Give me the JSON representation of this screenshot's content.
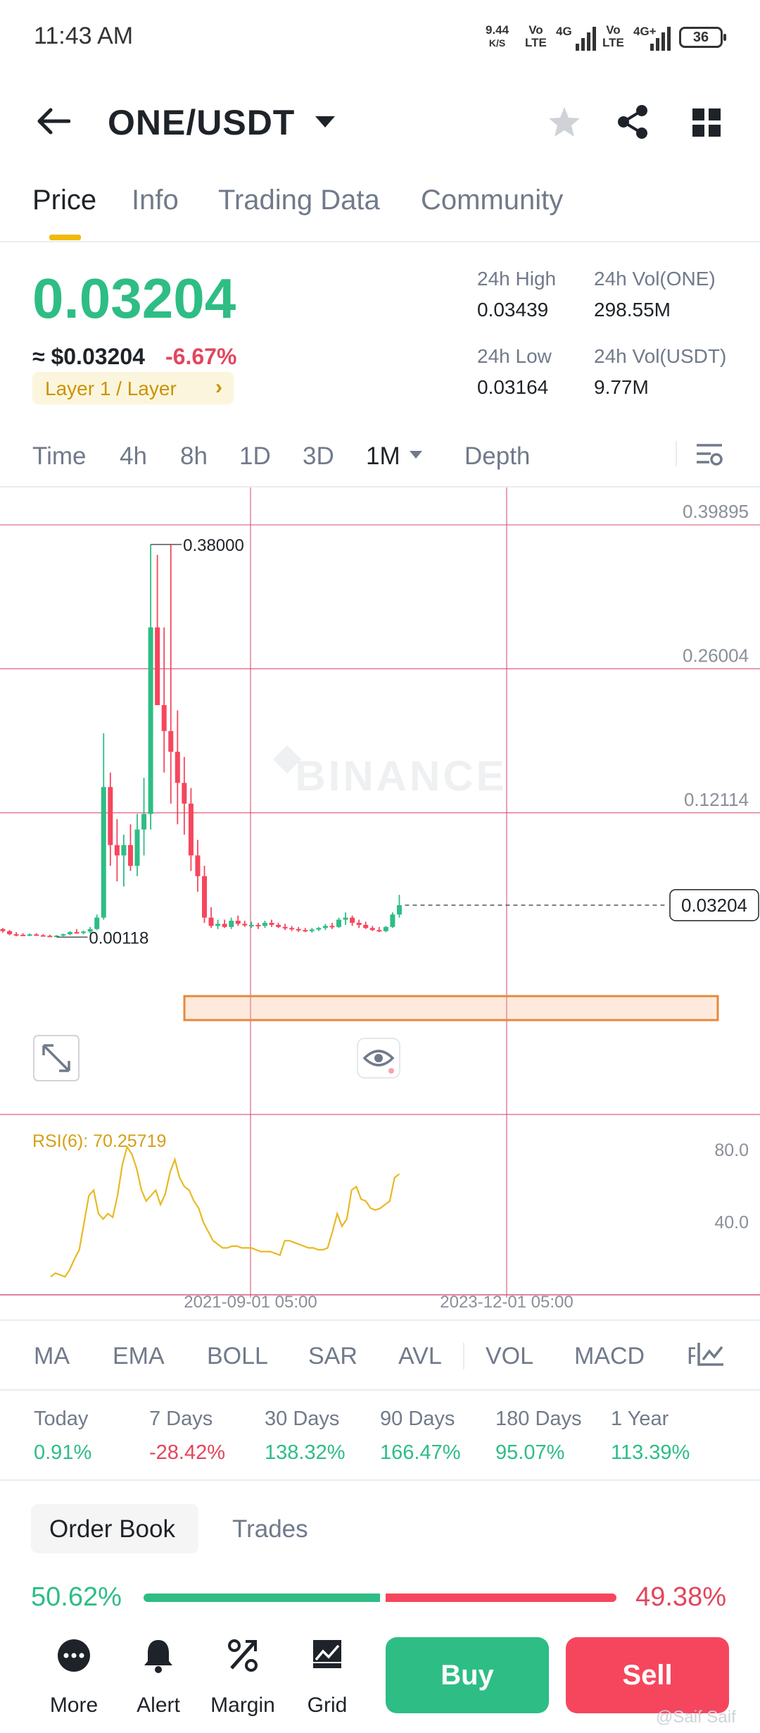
{
  "status_bar": {
    "time": "11:43 AM",
    "speed": "9.44",
    "speed_unit": "K/S",
    "sim1": "Vo",
    "sim1_sub": "LTE",
    "net1": "4G",
    "sim2": "Vo",
    "sim2_sub": "LTE",
    "net2": "4G+",
    "battery": "36"
  },
  "header": {
    "pair": "ONE/USDT",
    "icons": [
      "back-arrow-icon",
      "caret-down-icon",
      "star-icon",
      "share-icon",
      "grid-icon"
    ]
  },
  "tabs": [
    {
      "label": "Price",
      "active": true
    },
    {
      "label": "Info",
      "active": false
    },
    {
      "label": "Trading Data",
      "active": false
    },
    {
      "label": "Community",
      "active": false
    }
  ],
  "price": {
    "last": "0.03204",
    "usd_prefix": "≈",
    "usd": "$0.03204",
    "change": "-6.67%",
    "tag": "Layer 1 / Layer",
    "tag_chevron": "›"
  },
  "stats": {
    "high_label": "24h High",
    "high": "0.03439",
    "low_label": "24h Low",
    "low": "0.03164",
    "vol_one_label": "24h Vol(ONE)",
    "vol_one": "298.55M",
    "vol_usdt_label": "24h Vol(USDT)",
    "vol_usdt": "9.77M"
  },
  "intervals": {
    "items": [
      "Time",
      "4h",
      "8h",
      "1D",
      "3D"
    ],
    "active": "1M",
    "depth": "Depth"
  },
  "chart_data": {
    "type": "candlestick",
    "interval": "1M",
    "y_axis_labels": [
      "0.39895",
      "0.26004",
      "0.12114"
    ],
    "y_axis_values": [
      0.39895,
      0.26004,
      0.12114
    ],
    "ylim": [
      0.0,
      0.435
    ],
    "max_label": "0.38000",
    "min_label": "0.00118",
    "current_price_label": "0.03204",
    "current_price": 0.03204,
    "x_labels": [
      "2021-09-01 05:00",
      "2023-12-01 05:00"
    ],
    "watermark": "BINANCE",
    "colors": {
      "up": "#2ebd85",
      "down": "#f6465d",
      "grid": "#d8476e",
      "rsi": "#e8b923",
      "highlight": "#e8883a"
    },
    "candles": [
      {
        "o": 0.009,
        "h": 0.01,
        "l": 0.0055,
        "c": 0.007
      },
      {
        "o": 0.007,
        "h": 0.008,
        "l": 0.003,
        "c": 0.004
      },
      {
        "o": 0.004,
        "h": 0.006,
        "l": 0.002,
        "c": 0.0035
      },
      {
        "o": 0.0035,
        "h": 0.005,
        "l": 0.0025,
        "c": 0.0032
      },
      {
        "o": 0.0032,
        "h": 0.0048,
        "l": 0.0022,
        "c": 0.0038
      },
      {
        "o": 0.0038,
        "h": 0.005,
        "l": 0.0025,
        "c": 0.003
      },
      {
        "o": 0.003,
        "h": 0.0042,
        "l": 0.0018,
        "c": 0.0025
      },
      {
        "o": 0.0025,
        "h": 0.0035,
        "l": 0.0018,
        "c": 0.002
      },
      {
        "o": 0.002,
        "h": 0.0032,
        "l": 0.00118,
        "c": 0.0026
      },
      {
        "o": 0.0026,
        "h": 0.0045,
        "l": 0.002,
        "c": 0.004
      },
      {
        "o": 0.004,
        "h": 0.007,
        "l": 0.003,
        "c": 0.006
      },
      {
        "o": 0.006,
        "h": 0.009,
        "l": 0.0045,
        "c": 0.0055
      },
      {
        "o": 0.0055,
        "h": 0.0075,
        "l": 0.004,
        "c": 0.0065
      },
      {
        "o": 0.0065,
        "h": 0.011,
        "l": 0.005,
        "c": 0.009
      },
      {
        "o": 0.009,
        "h": 0.023,
        "l": 0.008,
        "c": 0.02
      },
      {
        "o": 0.02,
        "h": 0.198,
        "l": 0.018,
        "c": 0.146
      },
      {
        "o": 0.146,
        "h": 0.16,
        "l": 0.07,
        "c": 0.09
      },
      {
        "o": 0.09,
        "h": 0.115,
        "l": 0.055,
        "c": 0.08
      },
      {
        "o": 0.08,
        "h": 0.1,
        "l": 0.05,
        "c": 0.09
      },
      {
        "o": 0.09,
        "h": 0.11,
        "l": 0.065,
        "c": 0.07
      },
      {
        "o": 0.07,
        "h": 0.12,
        "l": 0.06,
        "c": 0.105
      },
      {
        "o": 0.105,
        "h": 0.155,
        "l": 0.08,
        "c": 0.12
      },
      {
        "o": 0.12,
        "h": 0.38,
        "l": 0.105,
        "c": 0.3
      },
      {
        "o": 0.3,
        "h": 0.37,
        "l": 0.24,
        "c": 0.225
      },
      {
        "o": 0.225,
        "h": 0.3,
        "l": 0.16,
        "c": 0.2
      },
      {
        "o": 0.2,
        "h": 0.38,
        "l": 0.13,
        "c": 0.18
      },
      {
        "o": 0.18,
        "h": 0.22,
        "l": 0.11,
        "c": 0.15
      },
      {
        "o": 0.15,
        "h": 0.175,
        "l": 0.1,
        "c": 0.13
      },
      {
        "o": 0.13,
        "h": 0.145,
        "l": 0.065,
        "c": 0.08
      },
      {
        "o": 0.08,
        "h": 0.095,
        "l": 0.045,
        "c": 0.06
      },
      {
        "o": 0.06,
        "h": 0.07,
        "l": 0.015,
        "c": 0.02
      },
      {
        "o": 0.02,
        "h": 0.03,
        "l": 0.01,
        "c": 0.012
      },
      {
        "o": 0.012,
        "h": 0.018,
        "l": 0.009,
        "c": 0.014
      },
      {
        "o": 0.014,
        "h": 0.018,
        "l": 0.01,
        "c": 0.011
      },
      {
        "o": 0.011,
        "h": 0.02,
        "l": 0.009,
        "c": 0.017
      },
      {
        "o": 0.017,
        "h": 0.022,
        "l": 0.012,
        "c": 0.014
      },
      {
        "o": 0.014,
        "h": 0.017,
        "l": 0.011,
        "c": 0.0125
      },
      {
        "o": 0.0125,
        "h": 0.016,
        "l": 0.01,
        "c": 0.013
      },
      {
        "o": 0.013,
        "h": 0.015,
        "l": 0.009,
        "c": 0.012
      },
      {
        "o": 0.012,
        "h": 0.017,
        "l": 0.01,
        "c": 0.015
      },
      {
        "o": 0.015,
        "h": 0.018,
        "l": 0.011,
        "c": 0.013
      },
      {
        "o": 0.013,
        "h": 0.015,
        "l": 0.01,
        "c": 0.011
      },
      {
        "o": 0.011,
        "h": 0.014,
        "l": 0.008,
        "c": 0.01
      },
      {
        "o": 0.01,
        "h": 0.012,
        "l": 0.007,
        "c": 0.009
      },
      {
        "o": 0.009,
        "h": 0.011,
        "l": 0.006,
        "c": 0.008
      },
      {
        "o": 0.008,
        "h": 0.01,
        "l": 0.006,
        "c": 0.007
      },
      {
        "o": 0.007,
        "h": 0.01,
        "l": 0.0055,
        "c": 0.0085
      },
      {
        "o": 0.0085,
        "h": 0.011,
        "l": 0.007,
        "c": 0.01
      },
      {
        "o": 0.01,
        "h": 0.014,
        "l": 0.008,
        "c": 0.012
      },
      {
        "o": 0.012,
        "h": 0.015,
        "l": 0.009,
        "c": 0.011
      },
      {
        "o": 0.011,
        "h": 0.02,
        "l": 0.01,
        "c": 0.018
      },
      {
        "o": 0.018,
        "h": 0.025,
        "l": 0.013,
        "c": 0.02
      },
      {
        "o": 0.02,
        "h": 0.022,
        "l": 0.012,
        "c": 0.015
      },
      {
        "o": 0.015,
        "h": 0.018,
        "l": 0.01,
        "c": 0.013
      },
      {
        "o": 0.013,
        "h": 0.016,
        "l": 0.009,
        "c": 0.01
      },
      {
        "o": 0.01,
        "h": 0.012,
        "l": 0.007,
        "c": 0.008
      },
      {
        "o": 0.008,
        "h": 0.011,
        "l": 0.006,
        "c": 0.007
      },
      {
        "o": 0.007,
        "h": 0.012,
        "l": 0.006,
        "c": 0.011
      },
      {
        "o": 0.011,
        "h": 0.025,
        "l": 0.01,
        "c": 0.023
      },
      {
        "o": 0.023,
        "h": 0.042,
        "l": 0.02,
        "c": 0.03204
      }
    ],
    "rsi": {
      "label": "RSI(6): 70.25719",
      "axis_labels": [
        "80.0",
        "40.0"
      ],
      "axis_values": [
        80,
        40
      ],
      "ylim": [
        0,
        100
      ],
      "values": [
        10,
        12,
        11,
        10,
        14,
        20,
        25,
        40,
        55,
        58,
        45,
        42,
        45,
        43,
        55,
        72,
        82,
        78,
        70,
        58,
        52,
        55,
        58,
        50,
        56,
        68,
        75,
        65,
        60,
        58,
        52,
        48,
        40,
        35,
        30,
        28,
        26,
        26,
        27,
        27,
        26,
        26,
        26,
        25,
        24,
        24,
        24,
        23,
        22,
        30,
        30,
        29,
        28,
        27,
        26,
        26,
        25,
        25,
        26,
        35,
        45,
        38,
        42,
        58,
        60,
        53,
        52,
        48,
        47,
        48,
        50,
        52,
        65,
        67
      ]
    }
  },
  "indicators": [
    "MA",
    "EMA",
    "BOLL",
    "SAR",
    "AVL",
    "VOL",
    "MACD",
    "R"
  ],
  "performance": [
    {
      "label": "Today",
      "value": "0.91%",
      "dir": "up"
    },
    {
      "label": "7 Days",
      "value": "-28.42%",
      "dir": "down"
    },
    {
      "label": "30 Days",
      "value": "138.32%",
      "dir": "up"
    },
    {
      "label": "90 Days",
      "value": "166.47%",
      "dir": "up"
    },
    {
      "label": "180 Days",
      "value": "95.07%",
      "dir": "up"
    },
    {
      "label": "1 Year",
      "value": "113.39%",
      "dir": "up"
    }
  ],
  "order_book": {
    "tab_active": "Order Book",
    "tab_other": "Trades",
    "bid_pct": "50.62%",
    "ask_pct": "49.38%",
    "bid_ratio": 0.5062
  },
  "bottom_nav": {
    "more": "More",
    "alert": "Alert",
    "margin": "Margin",
    "grid": "Grid",
    "buy": "Buy",
    "sell": "Sell"
  },
  "watermark_user": "@Saif Saif"
}
